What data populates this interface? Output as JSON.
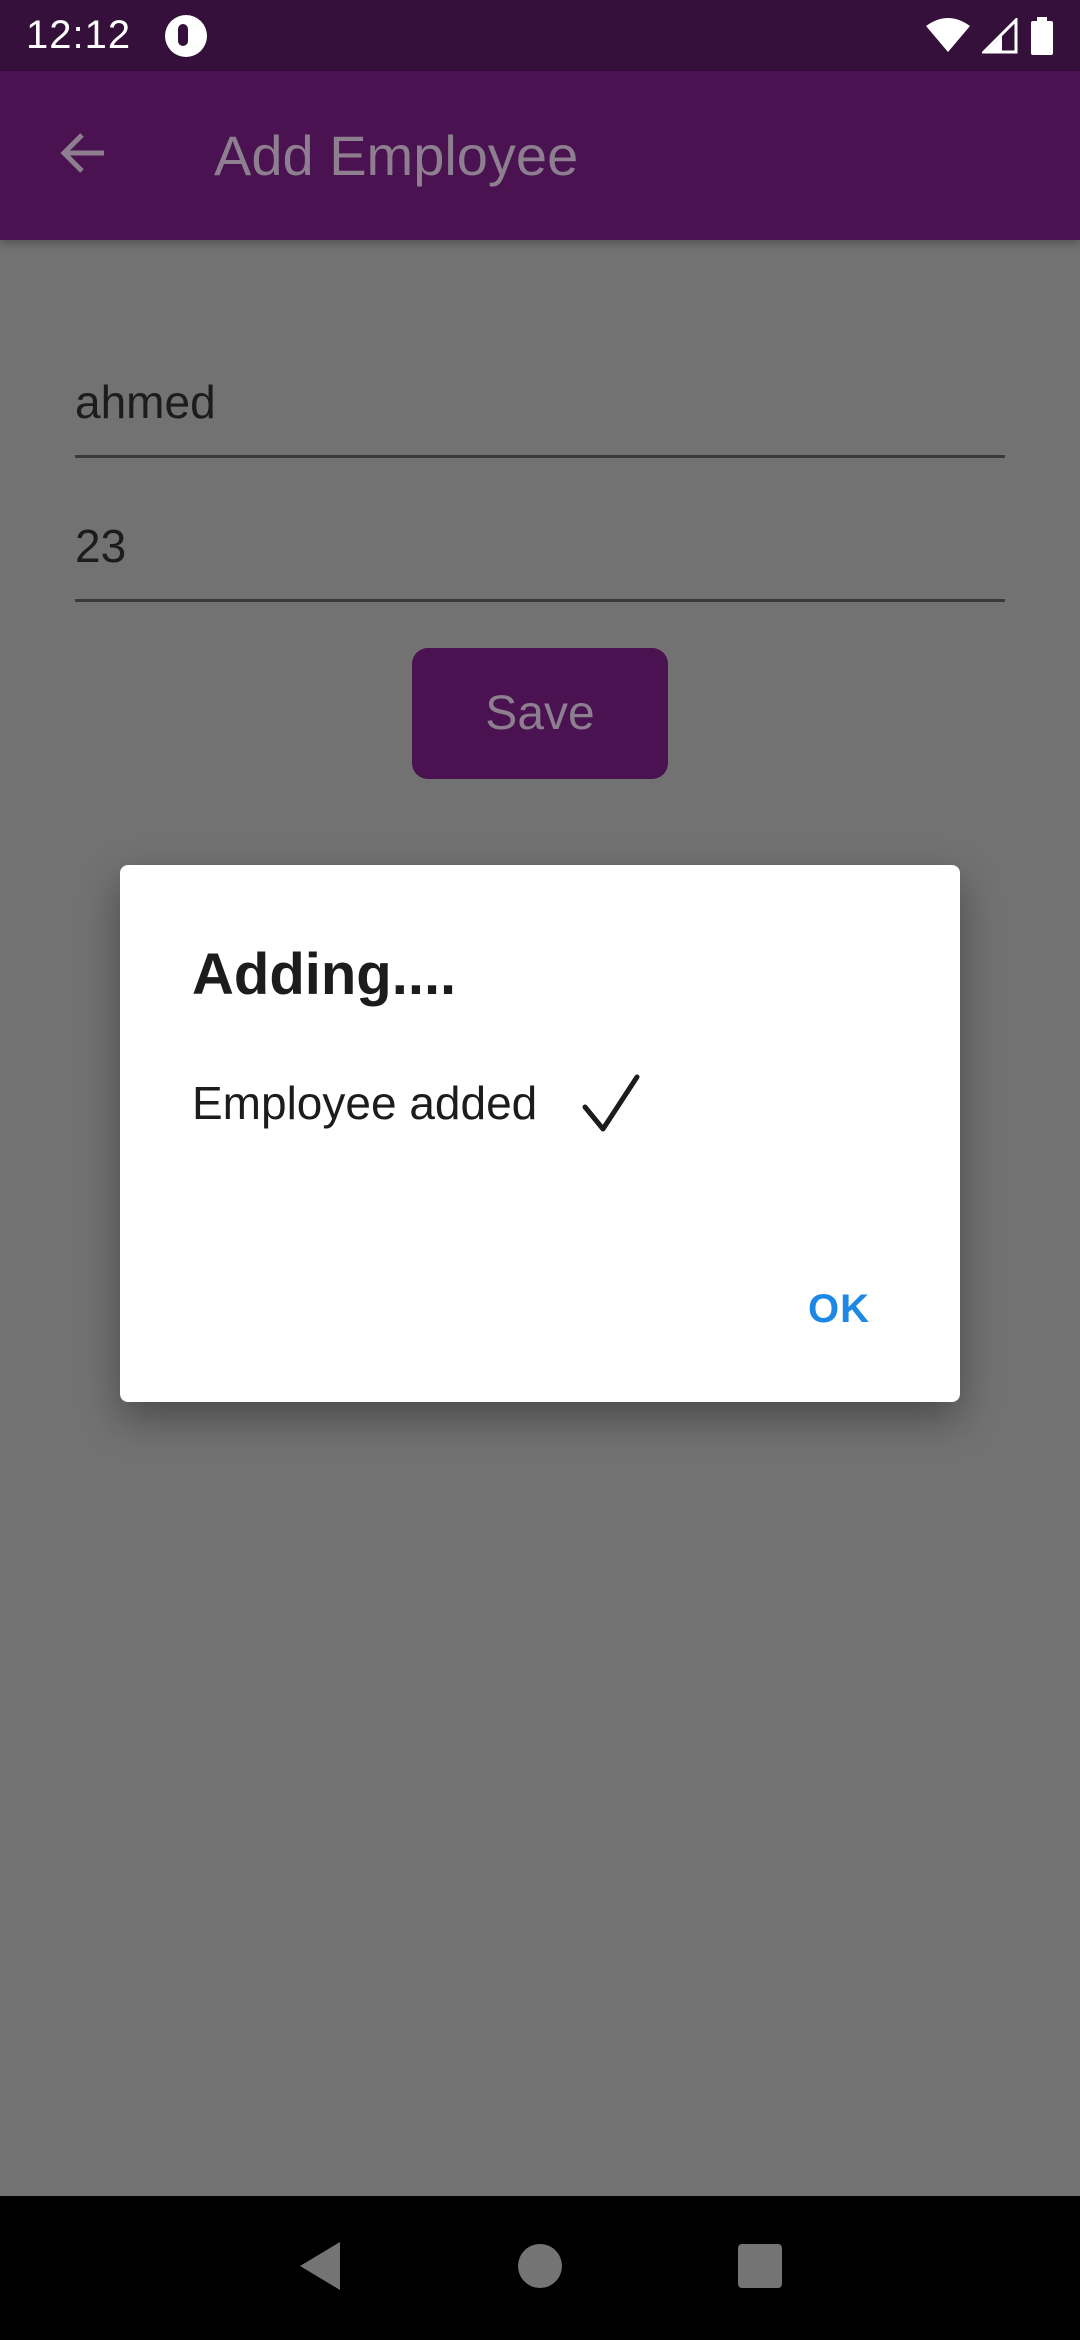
{
  "status_bar": {
    "time": "12:12",
    "icons": [
      "app-notification-icon",
      "wifi-icon",
      "signal-icon",
      "battery-icon"
    ]
  },
  "app_bar": {
    "title": "Add Employee",
    "back_icon": "arrow-left-icon"
  },
  "form": {
    "name_value": "ahmed",
    "age_value": "23",
    "save_label": "Save"
  },
  "dialog": {
    "title": "Adding....",
    "message": "Employee added",
    "check_icon": "checkmark-icon",
    "ok_label": "OK"
  },
  "nav_bar": {
    "icons": [
      "back-triangle-icon",
      "home-circle-icon",
      "recents-square-icon"
    ]
  },
  "colors": {
    "status_bar": "#35103a",
    "app_bar": "#4a1250",
    "scrim_background": "#727272",
    "dialog_button": "#1e88e5"
  }
}
